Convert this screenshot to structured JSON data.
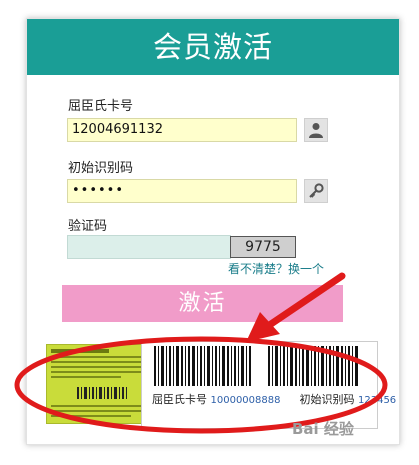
{
  "header": {
    "title": "会员激活"
  },
  "form": {
    "card_label": "屈臣氏卡号",
    "card_value": "12004691132",
    "code_label": "初始识别码",
    "code_value": "••••••",
    "captcha_label": "验证码",
    "captcha_value": "",
    "captcha_image_text": "9775",
    "refresh_link": "看不清楚？换一个",
    "submit_label": "激活"
  },
  "card_image": {
    "card_label": "屈臣氏卡号",
    "card_number": "10000008888",
    "code_label": "初始识别码",
    "code_number": "123456"
  },
  "icons": {
    "user": "user-icon",
    "key": "key-icon"
  },
  "colors": {
    "header": "#1a9e96",
    "button": "#f19cc9",
    "annotation": "#e01b1b"
  },
  "watermark": "Bai 经验"
}
